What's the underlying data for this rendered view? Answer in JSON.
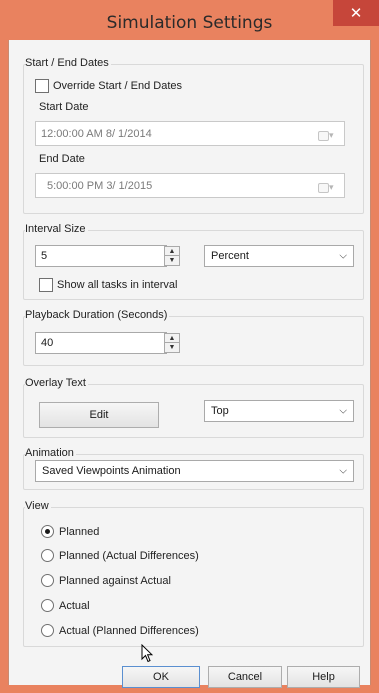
{
  "window": {
    "title": "Simulation Settings",
    "close_glyph": "✕"
  },
  "dates": {
    "group_label": "Start / End Dates",
    "override_label": "Override Start / End Dates",
    "override_checked": false,
    "start_label": "Start Date",
    "start_value": "12:00:00 AM  8/ 1/2014",
    "end_label": "End Date",
    "end_value": "5:00:00 PM  3/ 1/2015",
    "calendar_icon": "calendar-dropdown-icon"
  },
  "interval": {
    "group_label": "Interval Size",
    "value": "5",
    "unit_selected": "Percent",
    "show_all_label": "Show all tasks in interval",
    "show_all_checked": false
  },
  "playback": {
    "group_label": "Playback Duration (Seconds)",
    "value": "40"
  },
  "overlay": {
    "group_label": "Overlay Text",
    "edit_label": "Edit",
    "position_selected": "Top"
  },
  "animation": {
    "group_label": "Animation",
    "selected": "Saved Viewpoints Animation"
  },
  "view": {
    "group_label": "View",
    "options": [
      {
        "label": "Planned",
        "checked": true
      },
      {
        "label": "Planned (Actual Differences)",
        "checked": false
      },
      {
        "label": "Planned against Actual",
        "checked": false
      },
      {
        "label": "Actual",
        "checked": false
      },
      {
        "label": "Actual (Planned Differences)",
        "checked": false
      }
    ]
  },
  "buttons": {
    "ok_label": "OK",
    "cancel_label": "Cancel",
    "help_label": "Help"
  },
  "colors": {
    "frame": "#e9825f",
    "close": "#c6463a",
    "dialog_bg": "#f4f4f4"
  }
}
